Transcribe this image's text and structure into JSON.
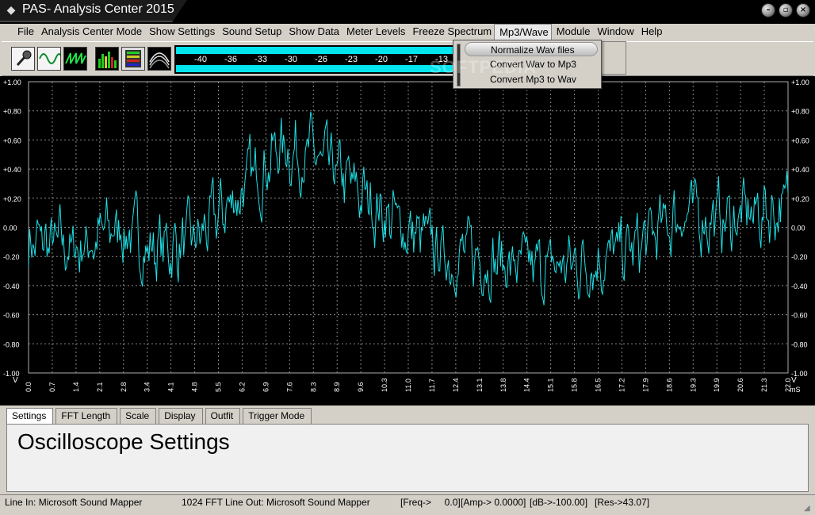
{
  "window": {
    "title": "PAS- Analysis Center 2015",
    "controls": [
      "minimize",
      "restore",
      "close"
    ]
  },
  "menu": [
    {
      "label": "File",
      "open": false
    },
    {
      "label": "Analysis Center Mode",
      "open": false
    },
    {
      "label": "Show Settings",
      "open": false
    },
    {
      "label": "Sound Setup",
      "open": false
    },
    {
      "label": "Show Data",
      "open": false
    },
    {
      "label": "Meter Levels",
      "open": false
    },
    {
      "label": "Freeze Spectrum",
      "open": false
    },
    {
      "label": "Mp3/Wave",
      "open": true
    },
    {
      "label": "Module",
      "open": false
    },
    {
      "label": "Window",
      "open": false
    },
    {
      "label": "Help",
      "open": false
    }
  ],
  "dropdown": {
    "items": [
      "Normalize Wav files",
      "Convert Wav to Mp3",
      "Convert Mp3 to Wav"
    ],
    "highlighted": 0
  },
  "toolbar": {
    "tools": [
      "microphone-icon",
      "sine-wave-icon",
      "sawtooth-wave-icon",
      "spectrum-icon",
      "meter-panel-icon",
      "waterfall-icon"
    ]
  },
  "meter": {
    "scale": [
      "-40",
      "-36",
      "-33",
      "-30",
      "-26",
      "-23",
      "-20",
      "-17",
      "-13"
    ],
    "color": "#00e5ee"
  },
  "watermark": "SOFTPEDIA",
  "scope": {
    "trace_color": "#1ee0e6",
    "grid_color": "#8a8a8a",
    "y_ticks": [
      "+1.00",
      "+0.80",
      "+0.60",
      "+0.40",
      "+0.20",
      "0.00",
      "-0.20",
      "-0.40",
      "-0.60",
      "-0.80",
      "-1.00"
    ],
    "y_unit": "V",
    "x_ticks": [
      "0.0",
      "0.7",
      "1.4",
      "2.1",
      "2.8",
      "3.4",
      "4.1",
      "4.8",
      "5.5",
      "6.2",
      "6.9",
      "7.6",
      "8.3",
      "8.9",
      "9.6",
      "10.3",
      "11.0",
      "11.7",
      "12.4",
      "13.1",
      "13.8",
      "14.4",
      "15.1",
      "15.8",
      "16.5",
      "17.2",
      "17.9",
      "18.6",
      "19.3",
      "19.9",
      "20.6",
      "21.3",
      "22.0"
    ],
    "x_unit": "mS"
  },
  "tabs": [
    {
      "label": "Settings",
      "active": true
    },
    {
      "label": "FFT Length",
      "active": false
    },
    {
      "label": "Scale",
      "active": false
    },
    {
      "label": "Display",
      "active": false
    },
    {
      "label": "Outfit",
      "active": false
    },
    {
      "label": "Trigger Mode",
      "active": false
    }
  ],
  "panel": {
    "title": "Oscilloscope Settings"
  },
  "status": {
    "line_in": "Line In: Microsoft Sound Mapper",
    "fft": "1024 FFT",
    "line_out": "Line Out: Microsoft Sound Mapper",
    "freq": "[Freq->     0.0]",
    "amp": "[Amp-> 0.0000]",
    "db": "[dB->-100.00]",
    "res": "[Res->43.07]"
  }
}
